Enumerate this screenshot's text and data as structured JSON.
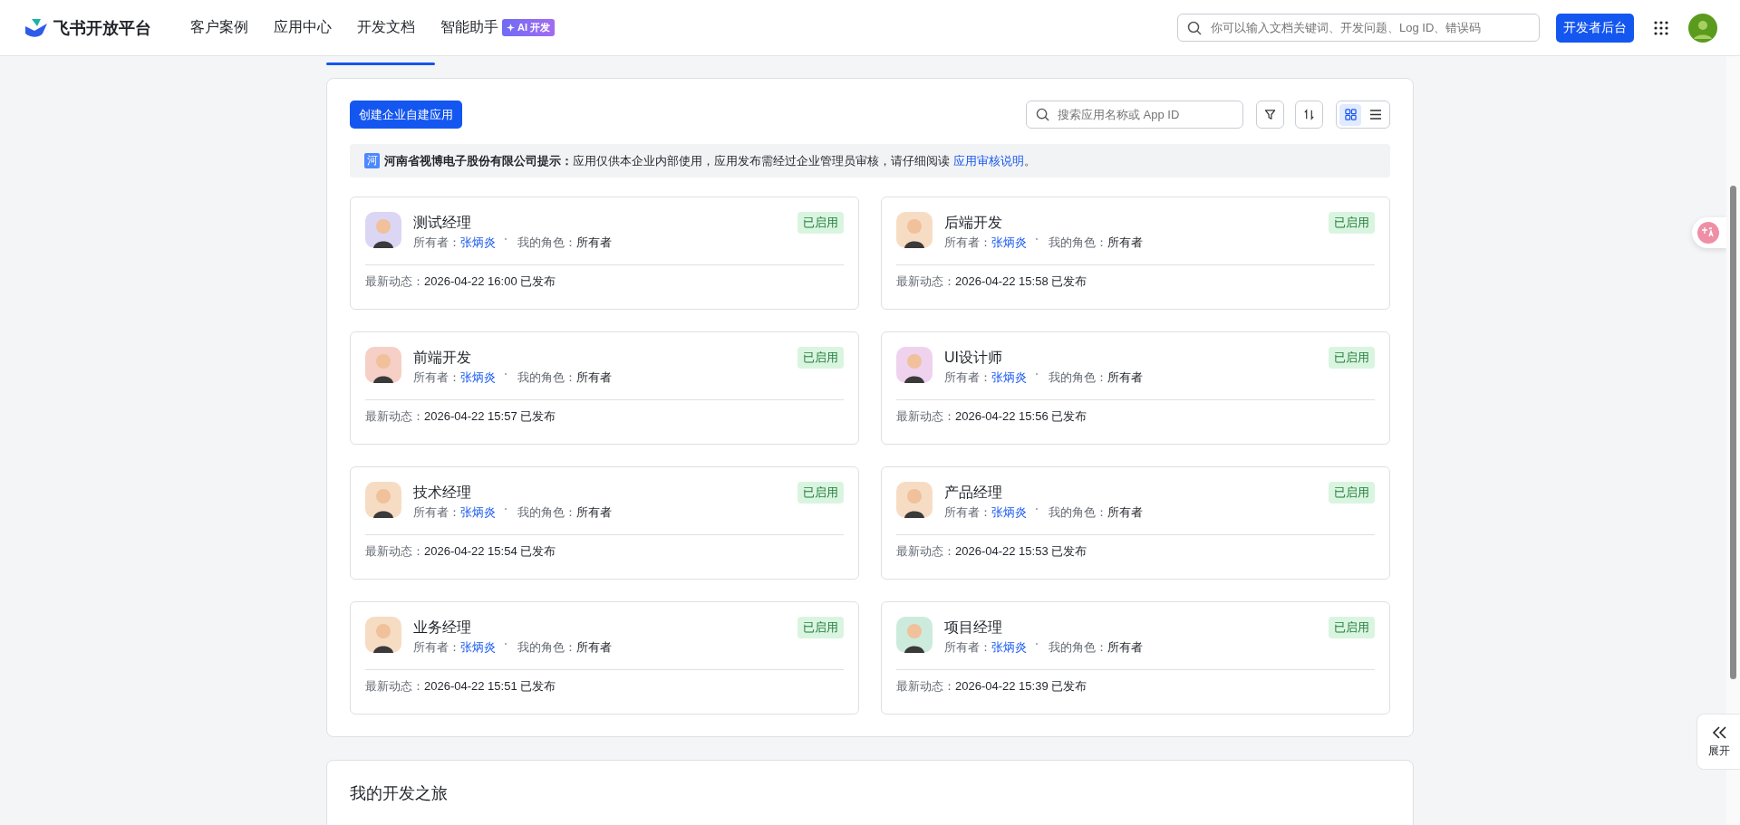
{
  "header": {
    "logo_text": "飞书开放平台",
    "nav": [
      {
        "label": "客户案例"
      },
      {
        "label": "应用中心"
      },
      {
        "label": "开发文档"
      },
      {
        "label": "智能助手",
        "badge": "AI 开发"
      }
    ],
    "search": {
      "placeholder": "你可以输入文档关键词、开发问题、Log ID、错误码"
    },
    "console_button": "开发者后台"
  },
  "toolbar": {
    "create_button": "创建企业自建应用",
    "search": {
      "placeholder": "搜索应用名称或 App ID"
    },
    "views": [
      {
        "kind": "grid",
        "selected": true
      },
      {
        "kind": "list",
        "selected": false
      }
    ]
  },
  "notice": {
    "icon_text": "河",
    "text": "**河南省视博电子股份有限公司提示：**应用仅供本企业内部使用，应用发布需经过企业管理员审核，请仔细阅读 ",
    "link": "应用审核说明",
    "end": "。"
  },
  "apps": [
    {
      "name": "测试经理",
      "color": "#dcd6f5",
      "owner_label": "所有者：",
      "owner": "张炳炎",
      "role_label": "我的角色：",
      "role": "所有者",
      "status": "已启用",
      "activity_label": "最新动态：",
      "activity": "2026-04-22 16:00 已发布"
    },
    {
      "name": "后端开发",
      "color": "#f7dcc4",
      "owner_label": "所有者：",
      "owner": "张炳炎",
      "role_label": "我的角色：",
      "role": "所有者",
      "status": "已启用",
      "activity_label": "最新动态：",
      "activity": "2026-04-22 15:58 已发布"
    },
    {
      "name": "前端开发",
      "color": "#f6cfc6",
      "owner_label": "所有者：",
      "owner": "张炳炎",
      "role_label": "我的角色：",
      "role": "所有者",
      "status": "已启用",
      "activity_label": "最新动态：",
      "activity": "2026-04-22 15:57 已发布"
    },
    {
      "name": "UI设计师",
      "color": "#efd3ee",
      "owner_label": "所有者：",
      "owner": "张炳炎",
      "role_label": "我的角色：",
      "role": "所有者",
      "status": "已启用",
      "activity_label": "最新动态：",
      "activity": "2026-04-22 15:56 已发布"
    },
    {
      "name": "技术经理",
      "color": "#f7dcc4",
      "owner_label": "所有者：",
      "owner": "张炳炎",
      "role_label": "我的角色：",
      "role": "所有者",
      "status": "已启用",
      "activity_label": "最新动态：",
      "activity": "2026-04-22 15:54 已发布"
    },
    {
      "name": "产品经理",
      "color": "#f7dcc4",
      "owner_label": "所有者：",
      "owner": "张炳炎",
      "role_label": "我的角色：",
      "role": "所有者",
      "status": "已启用",
      "activity_label": "最新动态：",
      "activity": "2026-04-22 15:53 已发布"
    },
    {
      "name": "业务经理",
      "color": "#f7dcc4",
      "owner_label": "所有者：",
      "owner": "张炳炎",
      "role_label": "我的角色：",
      "role": "所有者",
      "status": "已启用",
      "activity_label": "最新动态：",
      "activity": "2026-04-22 15:51 已发布"
    },
    {
      "name": "项目经理",
      "color": "#cdebdc",
      "owner_label": "所有者：",
      "owner": "张炳炎",
      "role_label": "我的角色：",
      "role": "所有者",
      "status": "已启用",
      "activity_label": "最新动态：",
      "activity": "2026-04-22 15:39 已发布"
    }
  ],
  "journey": {
    "title": "我的开发之旅"
  },
  "side": {
    "expand_label": "展开"
  }
}
